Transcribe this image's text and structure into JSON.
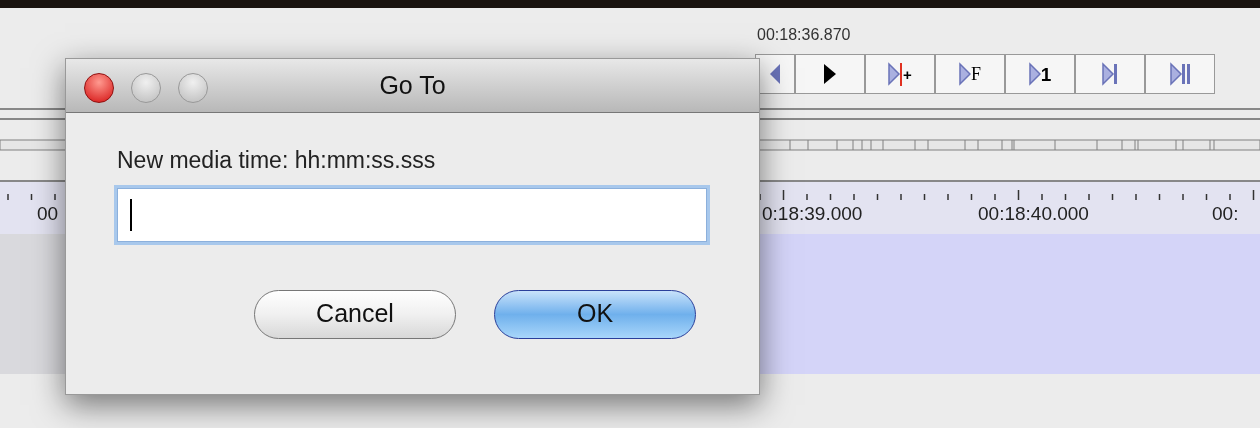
{
  "player": {
    "time": "00:18:36.870",
    "controls": [
      {
        "kind": "back"
      },
      {
        "kind": "play"
      },
      {
        "kind": "selection",
        "label": "+"
      },
      {
        "kind": "frame",
        "label": "F"
      },
      {
        "kind": "step",
        "label": "1"
      },
      {
        "kind": "end"
      },
      {
        "kind": "pause-end"
      }
    ]
  },
  "ruler": {
    "labels": [
      "00",
      "0:18:39.000",
      "00:18:40.000",
      "00:"
    ]
  },
  "dialog": {
    "title": "Go To",
    "prompt": "New media time: hh:mm:ss.sss",
    "field": {
      "focused": true
    },
    "buttons": [
      {
        "label": "Cancel",
        "default": false
      },
      {
        "label": "OK",
        "default": true
      }
    ]
  }
}
